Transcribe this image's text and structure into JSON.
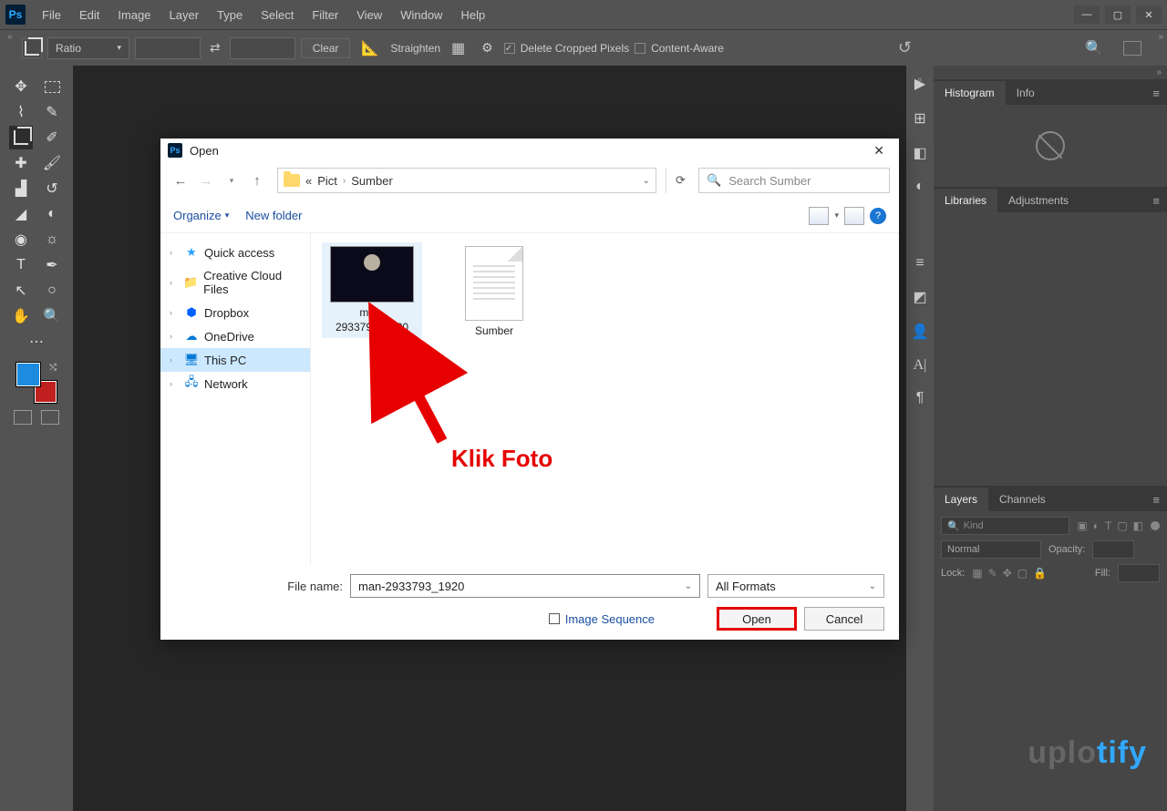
{
  "app": {
    "logo": "Ps"
  },
  "window_controls": {
    "min": "—",
    "max": "▢",
    "close": "✕"
  },
  "menubar": [
    "File",
    "Edit",
    "Image",
    "Layer",
    "Type",
    "Select",
    "Filter",
    "View",
    "Window",
    "Help"
  ],
  "optionsbar": {
    "ratio": "Ratio",
    "clear": "Clear",
    "straighten": "Straighten",
    "delete_cropped": "Delete Cropped Pixels",
    "content_aware": "Content-Aware"
  },
  "panels": {
    "histogram": "Histogram",
    "info": "Info",
    "libraries": "Libraries",
    "adjustments": "Adjustments",
    "layers": "Layers",
    "channels": "Channels",
    "kind_placeholder": "Kind",
    "blend": "Normal",
    "opacity_label": "Opacity:",
    "lock_label": "Lock:",
    "fill_label": "Fill:"
  },
  "dialog": {
    "title": "Open",
    "breadcrumb": {
      "prefix": "«",
      "seg1": "Pict",
      "seg2": "Sumber"
    },
    "search_placeholder": "Search Sumber",
    "organize": "Organize",
    "new_folder": "New folder",
    "sidebar": [
      {
        "label": "Quick access",
        "icon": "star"
      },
      {
        "label": "Creative Cloud Files",
        "icon": "cc"
      },
      {
        "label": "Dropbox",
        "icon": "dropbox"
      },
      {
        "label": "OneDrive",
        "icon": "onedrive"
      },
      {
        "label": "This PC",
        "icon": "pc",
        "selected": true
      },
      {
        "label": "Network",
        "icon": "network"
      }
    ],
    "files": [
      {
        "name": "man-2933793_1920",
        "type": "image",
        "selected": true
      },
      {
        "name": "Sumber",
        "type": "doc"
      }
    ],
    "filename_label": "File name:",
    "filename_value": "man-2933793_1920",
    "format": "All Formats",
    "image_sequence": "Image Sequence",
    "open": "Open",
    "cancel": "Cancel"
  },
  "annotation": {
    "text": "Klik Foto"
  },
  "watermark": {
    "part1": "uplo",
    "part2": "tify"
  }
}
